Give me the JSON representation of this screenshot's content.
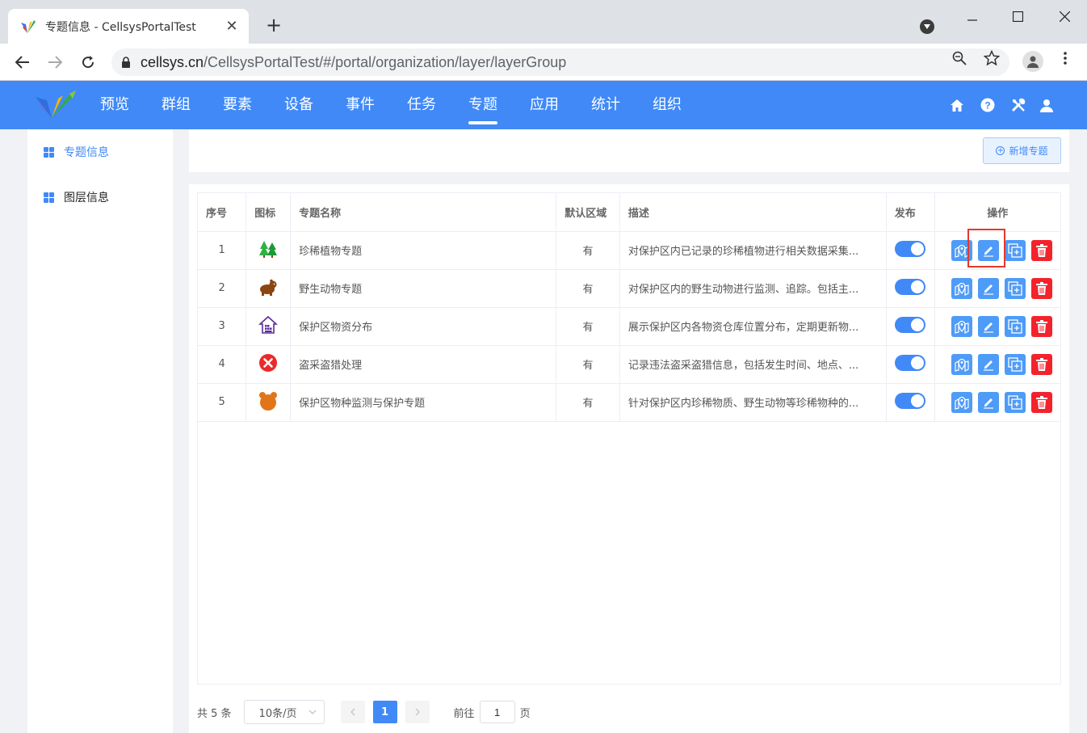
{
  "browser": {
    "tab_title": "专题信息 - CellsysPortalTest",
    "url_domain": "cellsys.cn",
    "url_path": "/CellsysPortalTest/#/portal/organization/layer/layerGroup"
  },
  "topnav": {
    "items": [
      {
        "label": "预览"
      },
      {
        "label": "群组"
      },
      {
        "label": "要素"
      },
      {
        "label": "设备"
      },
      {
        "label": "事件"
      },
      {
        "label": "任务"
      },
      {
        "label": "专题",
        "active": true
      },
      {
        "label": "应用"
      },
      {
        "label": "统计"
      },
      {
        "label": "组织"
      }
    ]
  },
  "sidebar": {
    "items": [
      {
        "label": "专题信息",
        "active": true
      },
      {
        "label": "图层信息",
        "active": false
      }
    ]
  },
  "toolbar": {
    "add_label": "新增专题"
  },
  "table": {
    "headers": [
      "序号",
      "图标",
      "专题名称",
      "默认区域",
      "描述",
      "发布",
      "操作"
    ],
    "rows": [
      {
        "index": "1",
        "icon": "tree-icon",
        "name": "珍稀植物专题",
        "default_area": "有",
        "desc": "对保护区内已记录的珍稀植物进行相关数据采集...",
        "published": true
      },
      {
        "index": "2",
        "icon": "animal-icon",
        "name": "野生动物专题",
        "default_area": "有",
        "desc": "对保护区内的野生动物进行监测、追踪。包括主...",
        "published": true
      },
      {
        "index": "3",
        "icon": "warehouse-icon",
        "name": "保护区物资分布",
        "default_area": "有",
        "desc": "展示保护区内各物资仓库位置分布，定期更新物...",
        "published": true
      },
      {
        "index": "4",
        "icon": "x-circle-icon",
        "name": "盗采盗猎处理",
        "default_area": "有",
        "desc": "记录违法盗采盗猎信息，包括发生时间、地点、...",
        "published": true
      },
      {
        "index": "5",
        "icon": "bear-icon",
        "name": "保护区物种监测与保护专题",
        "default_area": "有",
        "desc": "针对保护区内珍稀物质、野生动物等珍稀物种的...",
        "published": true
      }
    ]
  },
  "pager": {
    "total": "共 5 条",
    "page_size": "10条/页",
    "current": "1",
    "goto_prefix": "前往",
    "goto_value": "1",
    "goto_suffix": "页"
  },
  "colors": {
    "primary": "#4089f7",
    "danger": "#f3232c",
    "highlight": "#e5372d"
  }
}
